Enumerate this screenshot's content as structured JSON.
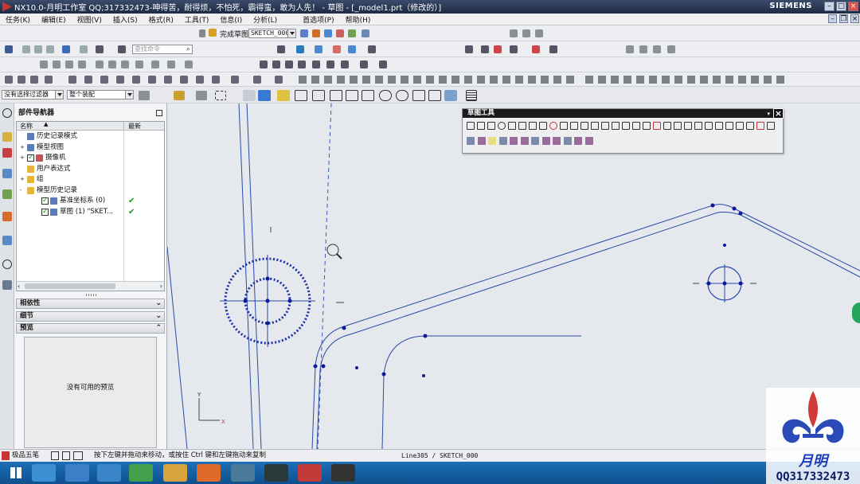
{
  "window": {
    "title": "NX10.0-月明工作室 QQ;317332473-呻得苦，耐得烦，不怕死，霸得蛮，敢为人先！ - 草图 - [_model1.prt（修改的）]",
    "brand": "SIEMENS"
  },
  "menu": [
    "任务(K)",
    "编辑(E)",
    "视图(V)",
    "插入(S)",
    "格式(R)",
    "工具(T)",
    "信息(I)",
    "分析(L)",
    "首选项(P)",
    "帮助(H)"
  ],
  "toolbar": {
    "finish_sketch": "完成草图",
    "sketch_name": "SKETCH_000",
    "search_placeholder": "查找命令",
    "filter": "没有选择过滤器",
    "assembly": "整个装配"
  },
  "navigator": {
    "title": "部件导航器",
    "columns": [
      "名称",
      "最新"
    ],
    "tree": [
      {
        "label": "历史记录模式",
        "indent": 0,
        "expand": "",
        "icon": "history-mode-icon",
        "check": false
      },
      {
        "label": "模型视图",
        "indent": 0,
        "expand": "+",
        "icon": "model-view-icon",
        "check": false
      },
      {
        "label": "摄像机",
        "indent": 0,
        "expand": "+",
        "icon": "camera-icon",
        "check": true
      },
      {
        "label": "用户表达式",
        "indent": 0,
        "expand": "",
        "icon": "folder-icon",
        "check": false
      },
      {
        "label": "组",
        "indent": 0,
        "expand": "+",
        "icon": "folder-icon",
        "check": false
      },
      {
        "label": "模型历史记录",
        "indent": 0,
        "expand": "-",
        "icon": "folder-icon",
        "check": false
      },
      {
        "label": "基准坐标系 (0)",
        "indent": 1,
        "expand": "",
        "icon": "datum-csys-icon",
        "check": true,
        "latest": true
      },
      {
        "label": "草图 (1) \"SKET...",
        "indent": 1,
        "expand": "",
        "icon": "sketch-icon",
        "check": true,
        "latest": true
      }
    ],
    "sections": {
      "dependency": "相依性",
      "detail": "细节",
      "preview": "预览"
    },
    "preview_text": "没有可用的预览"
  },
  "sketch_tools": {
    "title": "草图工具"
  },
  "status": {
    "ime": "极品五笔",
    "hint": "按下左键并拖动来移动，或按住 Ctrl 键和左键拖动来复制",
    "selection": "Line305 / SKETCH_000"
  },
  "watermark": {
    "name": "月明",
    "qq": "QQ317332473"
  },
  "canvas": {
    "axis_x": "X",
    "axis_y": "Y"
  },
  "colors": {
    "sketch_curve": "#1a2fa8",
    "constraint_point": "#0a1a99",
    "accent": "#1d6fb8"
  }
}
